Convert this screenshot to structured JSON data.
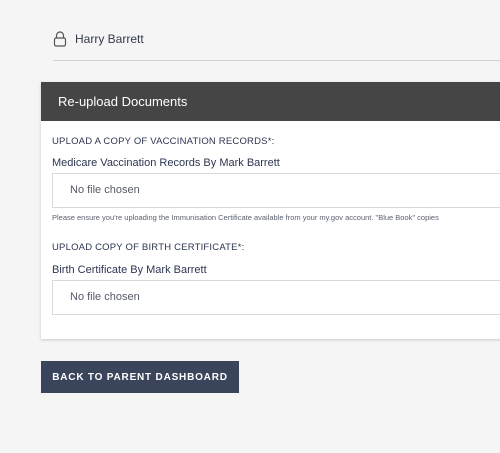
{
  "user": {
    "name": "Harry Barrett",
    "icon": "lock-icon"
  },
  "card": {
    "title": "Re-upload Documents",
    "sections": [
      {
        "label": "UPLOAD A COPY OF VACCINATION RECORDS*:",
        "document_title": "Medicare Vaccination Records By Mark Barrett",
        "file_status": "No file chosen",
        "help_text": "Please ensure you're uploading the Immunisation Certificate available from your my.gov account. \"Blue Book\" copies"
      },
      {
        "label": "UPLOAD COPY OF BIRTH CERTIFICATE*:",
        "document_title": "Birth Certificate By Mark Barrett",
        "file_status": "No file chosen"
      }
    ]
  },
  "actions": {
    "back_label": "BACK TO PARENT DASHBOARD"
  }
}
